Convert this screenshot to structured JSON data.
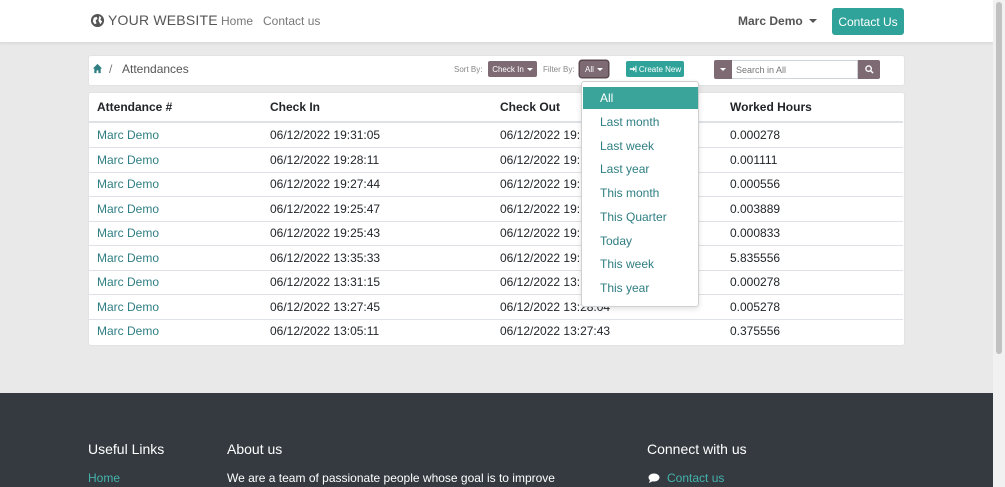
{
  "navbar": {
    "brand": "YOUR WEBSITE",
    "links": [
      "Home",
      "Contact us"
    ],
    "user": "Marc Demo",
    "cta": "Contact Us"
  },
  "toolbar": {
    "breadcrumb": {
      "separator": "/",
      "current": "Attendances"
    },
    "sort_label": "Sort By:",
    "sort_value": "Check In",
    "filter_label": "Filter By:",
    "filter_value": "All",
    "create_label": "Create New",
    "search_placeholder": "Search in All"
  },
  "table": {
    "headers": [
      "Attendance #",
      "Check In",
      "Check Out",
      "Worked Hours"
    ],
    "rows": [
      [
        "Marc Demo",
        "06/12/2022 19:31:05",
        "06/12/2022 19:",
        "0.000278"
      ],
      [
        "Marc Demo",
        "06/12/2022 19:28:11",
        "06/12/2022 19:",
        "0.001111"
      ],
      [
        "Marc Demo",
        "06/12/2022 19:27:44",
        "06/12/2022 19:",
        "0.000556"
      ],
      [
        "Marc Demo",
        "06/12/2022 19:25:47",
        "06/12/2022 19:",
        "0.003889"
      ],
      [
        "Marc Demo",
        "06/12/2022 19:25:43",
        "06/12/2022 19:",
        "0.000833"
      ],
      [
        "Marc Demo",
        "06/12/2022 13:35:33",
        "06/12/2022 19:",
        "5.835556"
      ],
      [
        "Marc Demo",
        "06/12/2022 13:31:15",
        "06/12/2022 13:",
        "0.000278"
      ],
      [
        "Marc Demo",
        "06/12/2022 13:27:45",
        "06/12/2022 13:28:04",
        "0.005278"
      ],
      [
        "Marc Demo",
        "06/12/2022 13:05:11",
        "06/12/2022 13:27:43",
        "0.375556"
      ]
    ]
  },
  "filter_menu": {
    "items": [
      "All",
      "Last month",
      "Last week",
      "Last year",
      "This month",
      "This Quarter",
      "Today",
      "This week",
      "This year"
    ],
    "active_index": 0
  },
  "footer": {
    "useful_links_title": "Useful Links",
    "useful_links_first": "Home",
    "about_title": "About us",
    "about_text": "We are a team of passionate people whose goal is to improve",
    "connect_title": "Connect with us",
    "connect_link": "Contact us"
  },
  "colors": {
    "primary": "#2fa39a",
    "secondary": "#7d6a72",
    "link": "#2f7e82",
    "footer_bg": "#343a40"
  }
}
